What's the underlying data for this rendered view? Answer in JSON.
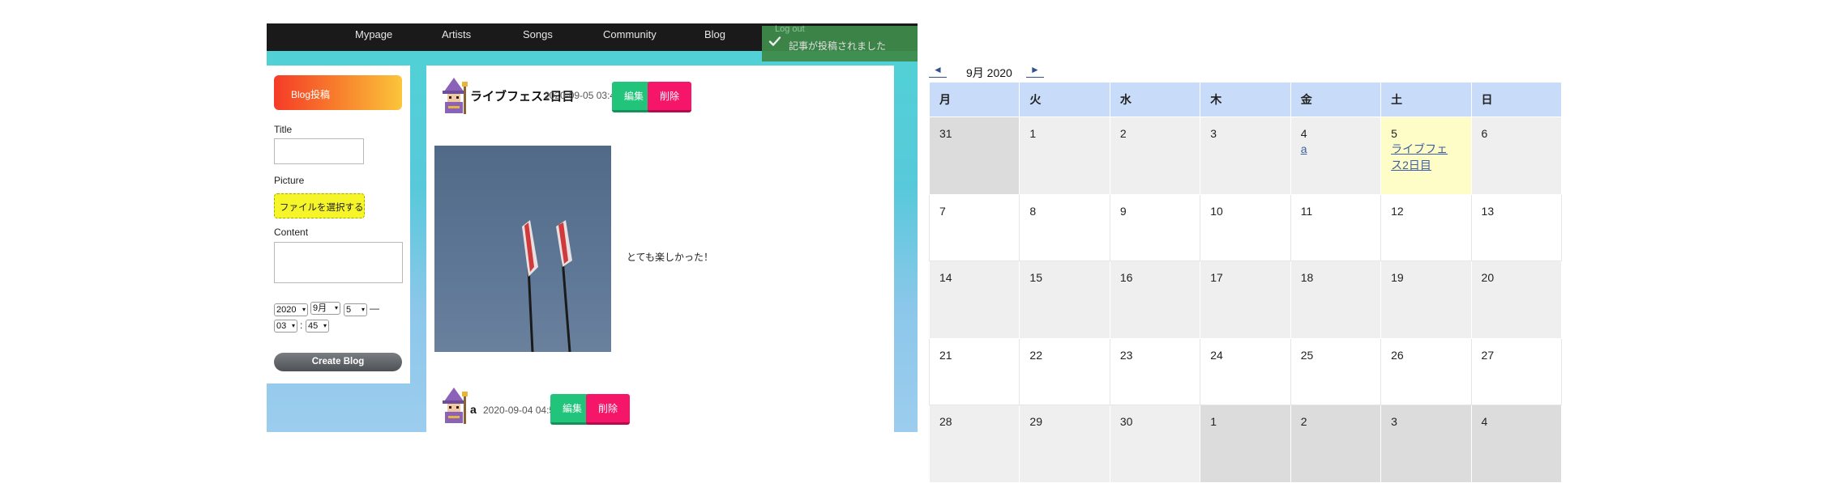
{
  "nav": {
    "items": [
      "Mypage",
      "Artists",
      "Songs",
      "Community",
      "Blog"
    ]
  },
  "toast": {
    "ghost_text": "Log out",
    "message": "記事が投稿されました"
  },
  "sidebar": {
    "header": "Blog投稿",
    "title_label": "Title",
    "title_value": "",
    "picture_label": "Picture",
    "file_button": "ファイルを選択する",
    "content_label": "Content",
    "content_value": "",
    "year": "2020",
    "month": "9月",
    "day": "5",
    "dash": "—",
    "hour": "03",
    "colon": ":",
    "minute": "45",
    "submit": "Create Blog"
  },
  "posts": [
    {
      "title": "ライブフェス2日目",
      "date": "2020-09-05 03:45",
      "edit": "編集",
      "delete": "削除",
      "body": "とても楽しかった！"
    },
    {
      "title": "a",
      "date": "2020-09-04 04:57",
      "edit": "編集",
      "delete": "削除"
    }
  ],
  "calendar": {
    "prev": "◄",
    "next": "►",
    "month_label": "9月 2020",
    "weekdays": [
      "月",
      "火",
      "水",
      "木",
      "金",
      "土",
      "日"
    ],
    "weeks": [
      [
        {
          "d": "31",
          "other": true
        },
        {
          "d": "1"
        },
        {
          "d": "2"
        },
        {
          "d": "3"
        },
        {
          "d": "4",
          "events": [
            "a"
          ]
        },
        {
          "d": "5",
          "today": true,
          "events": [
            "ライブフェ",
            "ス2日目"
          ]
        },
        {
          "d": "6"
        }
      ],
      [
        {
          "d": "7"
        },
        {
          "d": "8"
        },
        {
          "d": "9"
        },
        {
          "d": "10"
        },
        {
          "d": "11"
        },
        {
          "d": "12"
        },
        {
          "d": "13"
        }
      ],
      [
        {
          "d": "14"
        },
        {
          "d": "15"
        },
        {
          "d": "16"
        },
        {
          "d": "17"
        },
        {
          "d": "18"
        },
        {
          "d": "19"
        },
        {
          "d": "20"
        }
      ],
      [
        {
          "d": "21"
        },
        {
          "d": "22"
        },
        {
          "d": "23"
        },
        {
          "d": "24"
        },
        {
          "d": "25"
        },
        {
          "d": "26"
        },
        {
          "d": "27"
        }
      ],
      [
        {
          "d": "28"
        },
        {
          "d": "29"
        },
        {
          "d": "30"
        },
        {
          "d": "1",
          "other": true
        },
        {
          "d": "2",
          "other": true
        },
        {
          "d": "3",
          "other": true
        },
        {
          "d": "4",
          "other": true
        }
      ]
    ]
  },
  "colors": {
    "nav_bg": "#1a1a1a",
    "edit": "#21c47a",
    "delete": "#f5166a",
    "toast": "#3e8b4a",
    "calendar_header": "#c8dbf9",
    "today": "#fefdc7"
  }
}
